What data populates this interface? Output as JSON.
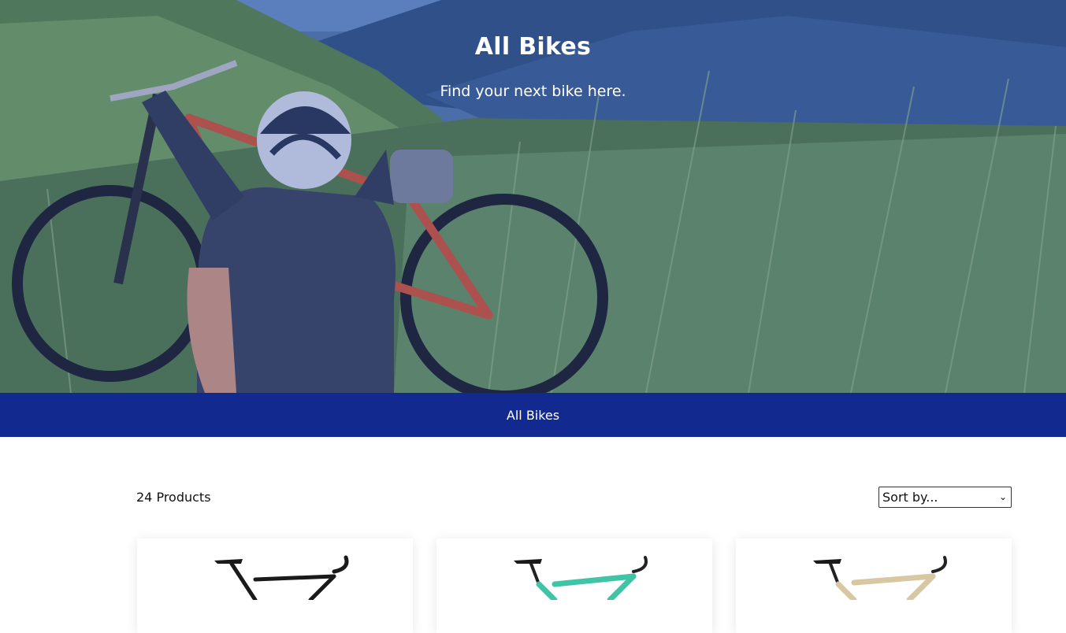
{
  "hero": {
    "title": "All Bikes",
    "subtitle": "Find your next bike here."
  },
  "nav": {
    "items": [
      {
        "label": "All Bikes"
      }
    ]
  },
  "toolbar": {
    "product_count": "24 Products",
    "sort": {
      "selected": "Sort by..."
    }
  },
  "products": [
    {
      "frame_color": "#1a1a1a"
    },
    {
      "frame_color": "#3fc4a6"
    },
    {
      "frame_color": "#d8c7a3"
    }
  ],
  "colors": {
    "nav_bg": "#12298f",
    "hero_overlay": "#2846aa"
  }
}
